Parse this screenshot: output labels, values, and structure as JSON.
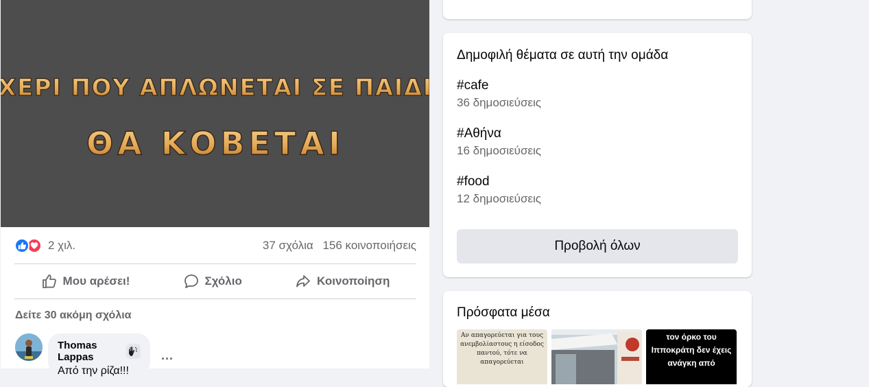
{
  "post": {
    "image_text_line1": "ΧΕΡΙ ΠΟΥ ΑΠΛΩΝΕΤΑΙ ΣΕ ΠΑΙΔΙ",
    "image_text_line2": "ΘΑ ΚΟΒΕΤΑΙ",
    "reaction_count": "2 χιλ.",
    "comments_count": "37 σχόλια",
    "shares_count": "156 κοινοποιήσεις",
    "actions": {
      "like": "Μου αρέσει!",
      "comment": "Σχόλιο",
      "share": "Κοινοποίηση"
    },
    "more_comments": "Δείτε 30 ακόμη σχόλια",
    "comment": {
      "author": "Thomas Lappas",
      "text": "Από την ρίζα!!!",
      "more": "..."
    }
  },
  "topics_card": {
    "title": "Δημοφιλή θέματα σε αυτή την ομάδα",
    "topics": [
      {
        "tag": "#cafe",
        "count": "36 δημοσιεύσεις"
      },
      {
        "tag": "#Αθήνα",
        "count": "16 δημοσιεύσεις"
      },
      {
        "tag": "#food",
        "count": "12 δημοσιεύσεις"
      }
    ],
    "see_all": "Προβολή όλων"
  },
  "media_card": {
    "title": "Πρόσφατα μέσα",
    "thumb1_text": "Αν απαγορεύεται για τους ανεμβολίαστους η είσοδος παντού, τότε να απαγορεύεται",
    "thumb3_text": "τον όρκο του Ιπποκράτη δεν έχεις ανάγκη από"
  },
  "colors": {
    "accent_blue": "#1877f2",
    "love_red": "#f33e58",
    "image_text_gold": "#e7b56a",
    "muted_text": "#65676b"
  }
}
